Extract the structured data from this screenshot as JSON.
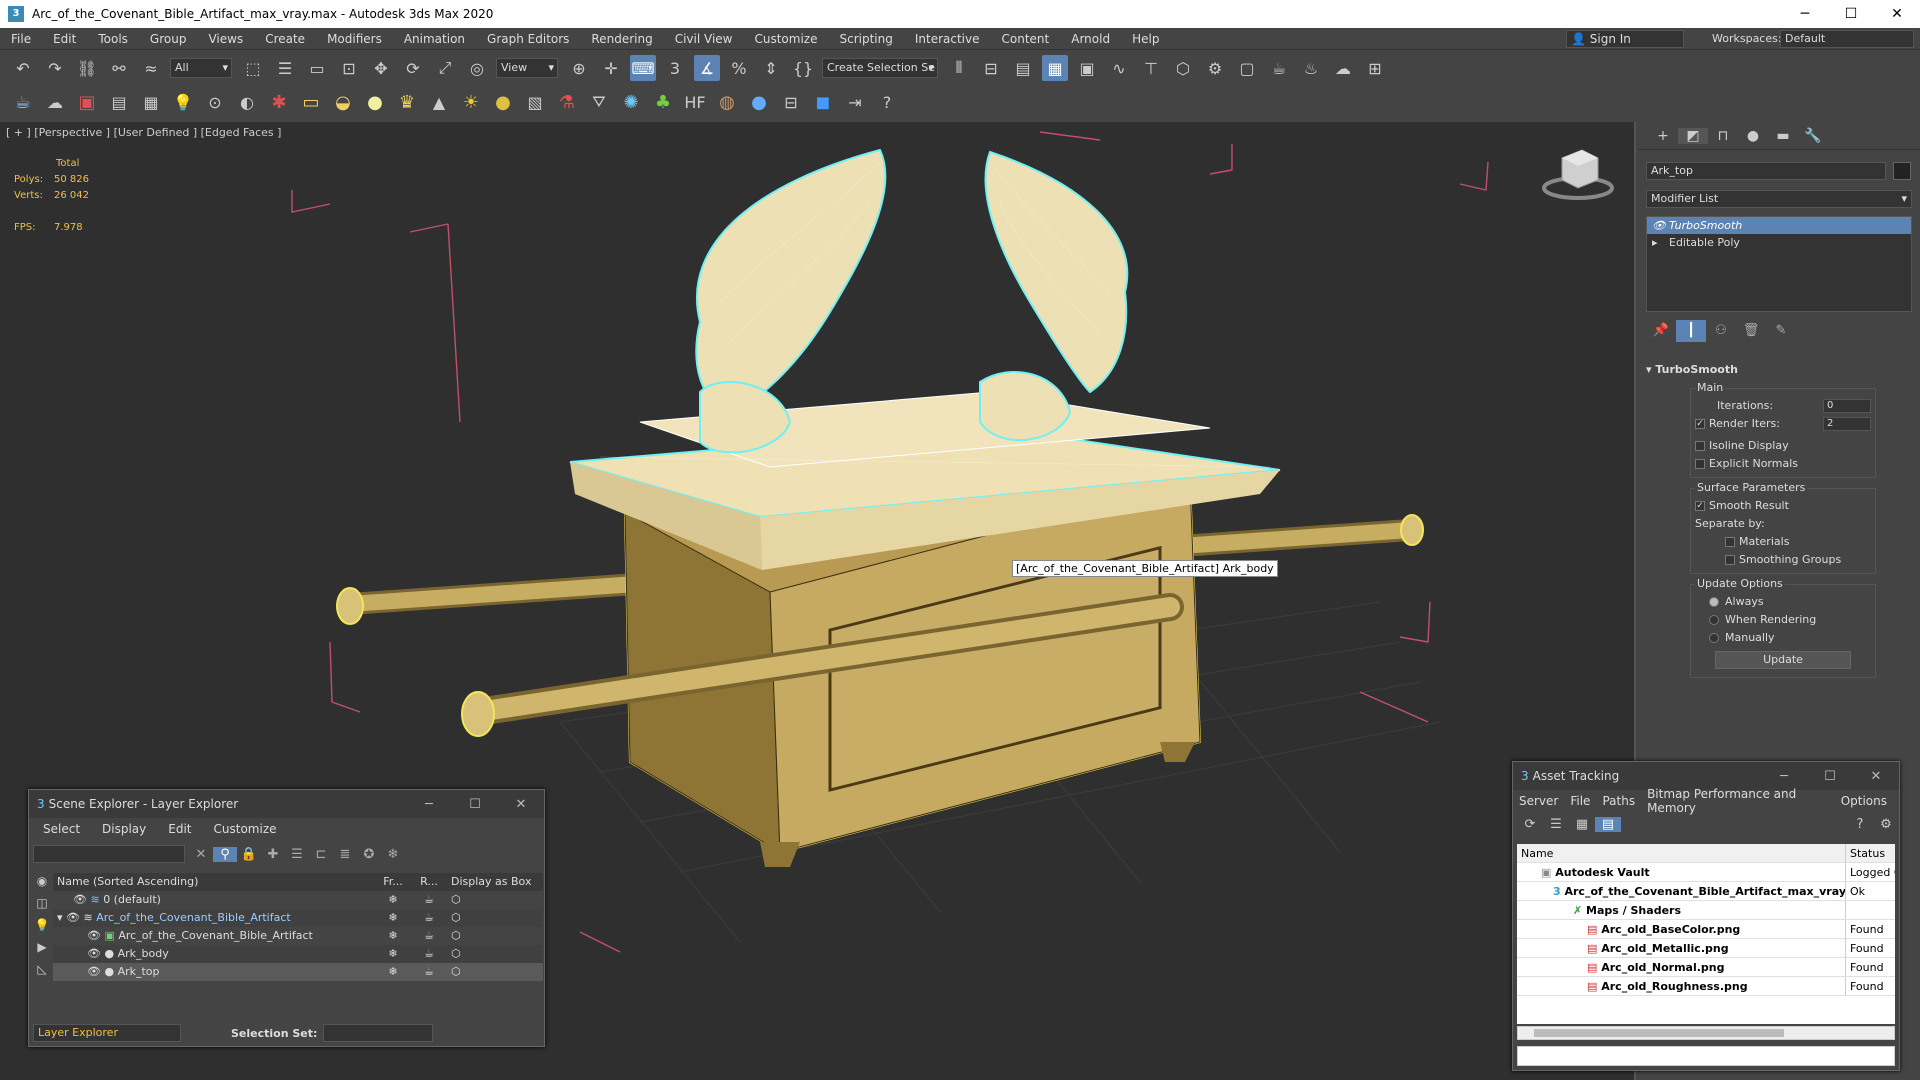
{
  "window": {
    "title": "Arc_of_the_Covenant_Bible_Artifact_max_vray.max - Autodesk 3ds Max 2020",
    "minimize": "─",
    "maximize": "☐",
    "close": "✕"
  },
  "menu": {
    "items": [
      "File",
      "Edit",
      "Tools",
      "Group",
      "Views",
      "Create",
      "Modifiers",
      "Animation",
      "Graph Editors",
      "Rendering",
      "Civil View",
      "Customize",
      "Scripting",
      "Interactive",
      "Content",
      "Arnold",
      "Help"
    ],
    "sign_in": "Sign In",
    "workspaces_label": "Workspaces:",
    "workspace": "Default"
  },
  "toolbar": {
    "filter": "All",
    "view": "View",
    "selection_set": "Create Selection Se"
  },
  "viewport": {
    "label": "[ + ] [Perspective ] [User Defined ] [Edged Faces ]",
    "stats_header": "Total",
    "polys_label": "Polys:",
    "polys": "50 826",
    "verts_label": "Verts:",
    "verts": "26 042",
    "fps_label": "FPS:",
    "fps": "7.978",
    "tooltip": "[Arc_of_the_Covenant_Bible_Artifact] Ark_body"
  },
  "command_panel": {
    "object_name": "Ark_top",
    "modifier_list": "Modifier List",
    "stack": [
      "TurboSmooth",
      "Editable Poly"
    ],
    "rollout_title": "TurboSmooth",
    "main_label": "Main",
    "iterations_label": "Iterations:",
    "iterations": "0",
    "render_iters_label": "Render Iters:",
    "render_iters": "2",
    "isoline": "Isoline Display",
    "explicit_normals": "Explicit Normals",
    "surface_params": "Surface Parameters",
    "smooth_result": "Smooth Result",
    "separate_by": "Separate by:",
    "materials": "Materials",
    "smoothing_groups": "Smoothing Groups",
    "update_options": "Update Options",
    "always": "Always",
    "when_rendering": "When Rendering",
    "manually": "Manually",
    "update_button": "Update"
  },
  "scene_explorer": {
    "title": "Scene Explorer - Layer Explorer",
    "menu": [
      "Select",
      "Display",
      "Edit",
      "Customize"
    ],
    "columns": [
      "Name (Sorted Ascending)",
      "Fr...",
      "R...",
      "Display as Box"
    ],
    "rows": [
      {
        "name": "0 (default)"
      },
      {
        "name": "Arc_of_the_Covenant_Bible_Artifact"
      },
      {
        "name": "Arc_of_the_Covenant_Bible_Artifact"
      },
      {
        "name": "Ark_body"
      },
      {
        "name": "Ark_top"
      }
    ],
    "layer_selector": "Layer Explorer",
    "selection_set_label": "Selection Set:"
  },
  "asset_tracking": {
    "title": "Asset Tracking",
    "menu": [
      "Server",
      "File",
      "Paths",
      "Bitmap Performance and Memory",
      "Options"
    ],
    "columns": [
      "Name",
      "Status"
    ],
    "rows": [
      {
        "name": "Autodesk Vault",
        "status": "Logged O"
      },
      {
        "name": "Arc_of_the_Covenant_Bible_Artifact_max_vray.max",
        "status": "Ok"
      },
      {
        "name": "Maps / Shaders",
        "status": ""
      },
      {
        "name": "Arc_old_BaseColor.png",
        "status": "Found"
      },
      {
        "name": "Arc_old_Metallic.png",
        "status": "Found"
      },
      {
        "name": "Arc_old_Normal.png",
        "status": "Found"
      },
      {
        "name": "Arc_old_Roughness.png",
        "status": "Found"
      }
    ]
  }
}
